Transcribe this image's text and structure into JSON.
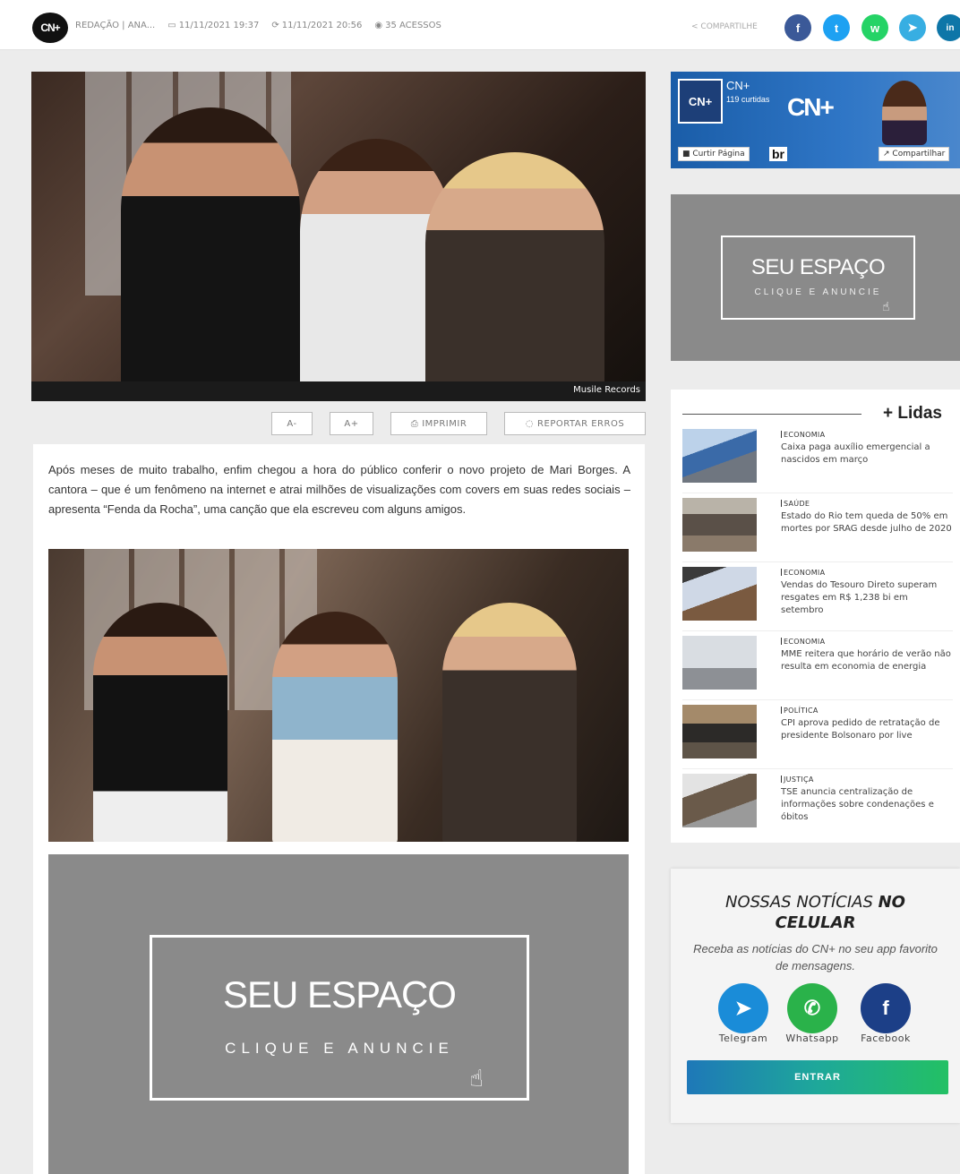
{
  "header": {
    "logo_text": "CN+",
    "author": "REDAÇÃO | ANA...",
    "published": "11/11/2021 19:37",
    "updated": "11/11/2021 20:56",
    "views": "35 ACESSOS",
    "share_label": "COMPARTILHE",
    "social": [
      {
        "name": "facebook",
        "glyph": "f",
        "color": "#3b5998"
      },
      {
        "name": "twitter",
        "glyph": "t",
        "color": "#1da1f2"
      },
      {
        "name": "whatsapp",
        "glyph": "w",
        "color": "#25d366"
      },
      {
        "name": "telegram",
        "glyph": "➤",
        "color": "#37aee2"
      },
      {
        "name": "linkedin",
        "glyph": "in",
        "color": "#0e76a8"
      }
    ]
  },
  "hero": {
    "credit": "Musile Records"
  },
  "toolbar": {
    "font_down": "A-",
    "font_up": "A+",
    "print": "IMPRIMIR",
    "report": "REPORTAR ERROS"
  },
  "article": {
    "paragraph": "Após meses de muito trabalho, enfim chegou a hora do público conferir o novo projeto de Mari Borges. A cantora – que é um fenômeno na internet e atrai milhões de visualizações com covers em suas redes sociais – apresenta “Fenda da Rocha”, uma canção que ela escreveu com alguns amigos."
  },
  "ad": {
    "title": "SEU ESPAÇO",
    "subtitle": "CLIQUE E ANUNCIE"
  },
  "fb_widget": {
    "page_name": "CN+",
    "likes": "119 curtidas",
    "brand": "CN+",
    "brand_suffix": "br",
    "like_button": "Curtir Página",
    "share_button": "Compartilhar"
  },
  "most_read": {
    "heading": "+ Lidas",
    "items": [
      {
        "category": "ECONOMIA",
        "title": "Caixa paga auxílio emergencial a nascidos em março"
      },
      {
        "category": "SAÚDE",
        "title": "Estado do Rio tem queda de 50% em mortes por SRAG desde julho de 2020"
      },
      {
        "category": "ECONOMIA",
        "title": "Vendas do Tesouro Direto superam resgates em R$ 1,238 bi em setembro"
      },
      {
        "category": "ECONOMIA",
        "title": "MME reitera que horário de verão não resulta em economia de energia"
      },
      {
        "category": "POLÍTICA",
        "title": "CPI aprova pedido de retratação de presidente Bolsonaro por live"
      },
      {
        "category": "JUSTIÇA",
        "title": "TSE anuncia centralização de informações sobre condenações e óbitos"
      }
    ]
  },
  "mobile_box": {
    "title_part1": "NOSSAS NOTÍCIAS",
    "title_part2": "NO",
    "title_part3": "CELULAR",
    "description": "Receba as notícias do CN+ no seu app favorito de mensagens.",
    "apps": [
      {
        "label": "Telegram",
        "color": "#1a8cd8"
      },
      {
        "label": "Whatsapp",
        "color": "#2ab24a"
      },
      {
        "label": "Facebook",
        "color": "#1c3f87"
      }
    ],
    "button": "ENTRAR"
  }
}
